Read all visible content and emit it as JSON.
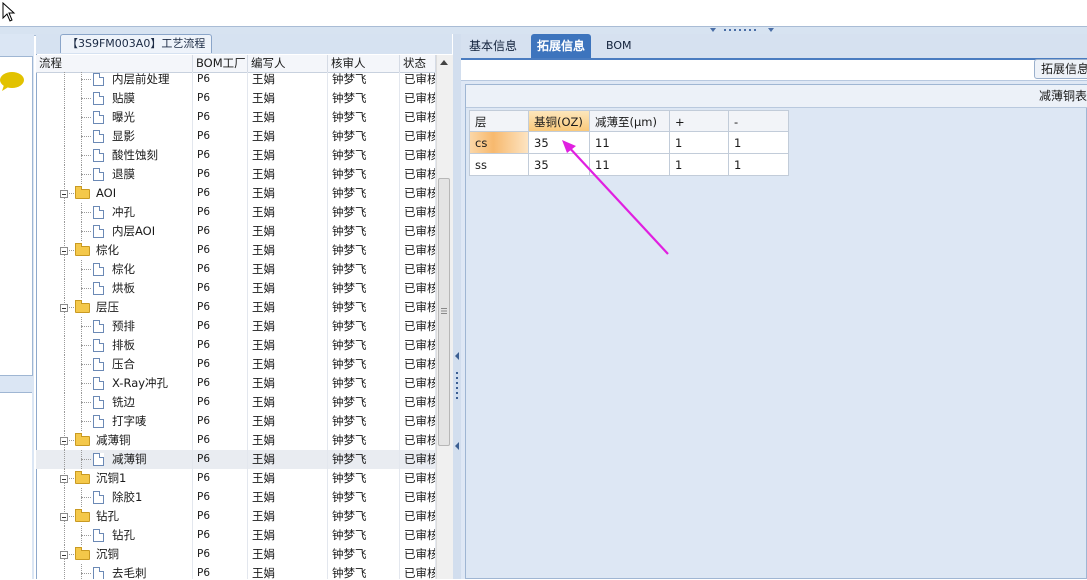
{
  "app": {
    "process_tab": "【3S9FM003A0】工艺流程"
  },
  "tree": {
    "columns": [
      "流程",
      "BOM工厂",
      "编写人",
      "核审人",
      "状态"
    ],
    "rows": [
      {
        "name": "内层前处理",
        "level": 2,
        "type": "file",
        "factory": "P6",
        "writer": "王娟",
        "reviewer": "钟梦飞",
        "status": "已审核"
      },
      {
        "name": "贴膜",
        "level": 2,
        "type": "file",
        "factory": "P6",
        "writer": "王娟",
        "reviewer": "钟梦飞",
        "status": "已审核"
      },
      {
        "name": "曝光",
        "level": 2,
        "type": "file",
        "factory": "P6",
        "writer": "王娟",
        "reviewer": "钟梦飞",
        "status": "已审核"
      },
      {
        "name": "显影",
        "level": 2,
        "type": "file",
        "factory": "P6",
        "writer": "王娟",
        "reviewer": "钟梦飞",
        "status": "已审核"
      },
      {
        "name": "酸性蚀刻",
        "level": 2,
        "type": "file",
        "factory": "P6",
        "writer": "王娟",
        "reviewer": "钟梦飞",
        "status": "已审核"
      },
      {
        "name": "退膜",
        "level": 2,
        "type": "file",
        "factory": "P6",
        "writer": "王娟",
        "reviewer": "钟梦飞",
        "status": "已审核"
      },
      {
        "name": "AOI",
        "level": 1,
        "type": "folder",
        "factory": "P6",
        "writer": "王娟",
        "reviewer": "钟梦飞",
        "status": "已审核"
      },
      {
        "name": "冲孔",
        "level": 2,
        "type": "file",
        "factory": "P6",
        "writer": "王娟",
        "reviewer": "钟梦飞",
        "status": "已审核"
      },
      {
        "name": "内层AOI",
        "level": 2,
        "type": "file",
        "factory": "P6",
        "writer": "王娟",
        "reviewer": "钟梦飞",
        "status": "已审核"
      },
      {
        "name": "棕化",
        "level": 1,
        "type": "folder",
        "factory": "P6",
        "writer": "王娟",
        "reviewer": "钟梦飞",
        "status": "已审核"
      },
      {
        "name": "棕化",
        "level": 2,
        "type": "file",
        "factory": "P6",
        "writer": "王娟",
        "reviewer": "钟梦飞",
        "status": "已审核"
      },
      {
        "name": "烘板",
        "level": 2,
        "type": "file",
        "factory": "P6",
        "writer": "王娟",
        "reviewer": "钟梦飞",
        "status": "已审核"
      },
      {
        "name": "层压",
        "level": 1,
        "type": "folder",
        "factory": "P6",
        "writer": "王娟",
        "reviewer": "钟梦飞",
        "status": "已审核"
      },
      {
        "name": "预排",
        "level": 2,
        "type": "file",
        "factory": "P6",
        "writer": "王娟",
        "reviewer": "钟梦飞",
        "status": "已审核"
      },
      {
        "name": "排板",
        "level": 2,
        "type": "file",
        "factory": "P6",
        "writer": "王娟",
        "reviewer": "钟梦飞",
        "status": "已审核"
      },
      {
        "name": "压合",
        "level": 2,
        "type": "file",
        "factory": "P6",
        "writer": "王娟",
        "reviewer": "钟梦飞",
        "status": "已审核"
      },
      {
        "name": "X-Ray冲孔",
        "level": 2,
        "type": "file",
        "factory": "P6",
        "writer": "王娟",
        "reviewer": "钟梦飞",
        "status": "已审核"
      },
      {
        "name": "铣边",
        "level": 2,
        "type": "file",
        "factory": "P6",
        "writer": "王娟",
        "reviewer": "钟梦飞",
        "status": "已审核"
      },
      {
        "name": "打字唛",
        "level": 2,
        "type": "file",
        "factory": "P6",
        "writer": "王娟",
        "reviewer": "钟梦飞",
        "status": "已审核"
      },
      {
        "name": "减薄铜",
        "level": 1,
        "type": "folder",
        "factory": "P6",
        "writer": "王娟",
        "reviewer": "钟梦飞",
        "status": "已审核"
      },
      {
        "name": "减薄铜",
        "level": 2,
        "type": "file",
        "factory": "P6",
        "writer": "王娟",
        "reviewer": "钟梦飞",
        "status": "已审核",
        "selected": true
      },
      {
        "name": "沉铜1",
        "level": 1,
        "type": "folder",
        "factory": "P6",
        "writer": "王娟",
        "reviewer": "钟梦飞",
        "status": "已审核"
      },
      {
        "name": "除胶1",
        "level": 2,
        "type": "file",
        "factory": "P6",
        "writer": "王娟",
        "reviewer": "钟梦飞",
        "status": "已审核"
      },
      {
        "name": "钻孔",
        "level": 1,
        "type": "folder",
        "factory": "P6",
        "writer": "王娟",
        "reviewer": "钟梦飞",
        "status": "已审核"
      },
      {
        "name": "钻孔",
        "level": 2,
        "type": "file",
        "factory": "P6",
        "writer": "王娟",
        "reviewer": "钟梦飞",
        "status": "已审核"
      },
      {
        "name": "沉铜",
        "level": 1,
        "type": "folder",
        "factory": "P6",
        "writer": "王娟",
        "reviewer": "钟梦飞",
        "status": "已审核"
      },
      {
        "name": "去毛刺",
        "level": 2,
        "type": "file",
        "factory": "P6",
        "writer": "王娟",
        "reviewer": "钟梦飞",
        "status": "已审核"
      }
    ]
  },
  "right": {
    "tabs": [
      {
        "label": "基本信息",
        "active": false
      },
      {
        "label": "拓展信息",
        "active": true
      },
      {
        "label": "BOM",
        "active": false
      }
    ],
    "ext_button": "拓展信息",
    "section_title": "减薄铜表",
    "grid": {
      "columns": [
        "层",
        "基铜(OZ)",
        "减薄至(μm)",
        "+",
        "-"
      ],
      "rows": [
        [
          "cs",
          "35",
          "11",
          "1",
          "1"
        ],
        [
          "ss",
          "35",
          "11",
          "1",
          "1"
        ]
      ]
    }
  },
  "colors": {
    "active_tab": "#3d74bd",
    "annotation_arrow": "#e020e0",
    "highlight": "#f7b96e"
  }
}
